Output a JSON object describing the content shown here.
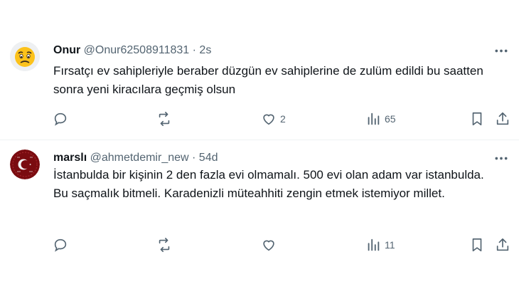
{
  "tweets": [
    {
      "display_name": "Onur",
      "handle": "@Onur62508911831",
      "separator": "·",
      "time": "2s",
      "avatar_icon": "worried-face-emoji",
      "text": "Fırsatçı ev sahipleriyle beraber düzgün ev sahiplerine de zulüm edildi bu saatten sonra yeni kiracılara geçmiş olsun",
      "reply_count": "",
      "repost_count": "",
      "like_count": "2",
      "view_count": "65"
    },
    {
      "display_name": "marslı",
      "handle": "@ahmetdemir_new",
      "separator": "·",
      "time": "54d",
      "avatar_icon": "red-crescent-emblem",
      "text": "İstanbulda bir kişinin 2 den fazla evi olmamalı. 500 evi olan adam var istanbulda. Bu saçmalık bitmeli. Karadenizli müteahhiti zengin etmek istemiyor millet.",
      "reply_count": "",
      "repost_count": "",
      "like_count": "",
      "view_count": "11"
    }
  ],
  "colors": {
    "text_primary": "#0f1419",
    "text_secondary": "#536471",
    "divider": "#eff3f4",
    "avatar_red": "#8b0f14"
  }
}
